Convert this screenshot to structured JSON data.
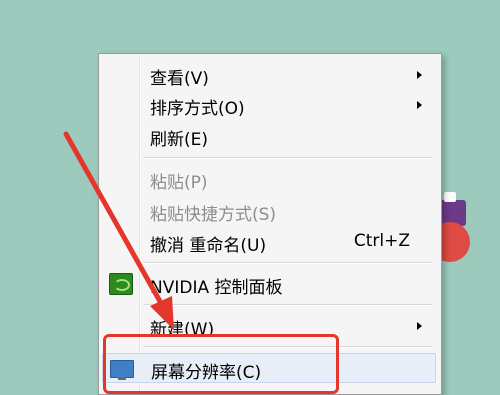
{
  "context_menu": {
    "items": [
      {
        "label": "查看(V)",
        "shortcut": "",
        "submenu": true,
        "disabled": false
      },
      {
        "label": "排序方式(O)",
        "shortcut": "",
        "submenu": true,
        "disabled": false
      },
      {
        "label": "刷新(E)",
        "shortcut": "",
        "submenu": false,
        "disabled": false
      },
      {
        "label": "粘贴(P)",
        "shortcut": "",
        "submenu": false,
        "disabled": true
      },
      {
        "label": "粘贴快捷方式(S)",
        "shortcut": "",
        "submenu": false,
        "disabled": true
      },
      {
        "label": "撤消 重命名(U)",
        "shortcut": "Ctrl+Z",
        "submenu": false,
        "disabled": false
      },
      {
        "label": "NVIDIA 控制面板",
        "shortcut": "",
        "submenu": false,
        "disabled": false,
        "icon": "nvidia-icon"
      },
      {
        "label": "新建(W)",
        "shortcut": "",
        "submenu": true,
        "disabled": false
      },
      {
        "label": "屏幕分辨率(C)",
        "shortcut": "",
        "submenu": false,
        "disabled": false,
        "icon": "monitor-icon",
        "highlighted": true
      }
    ]
  },
  "annotation": {
    "color": "#e5362b"
  },
  "colors": {
    "desktop": "#9ccbbd",
    "menu_bg": "#f5f5f5",
    "disabled_text": "#8d8d8d"
  }
}
